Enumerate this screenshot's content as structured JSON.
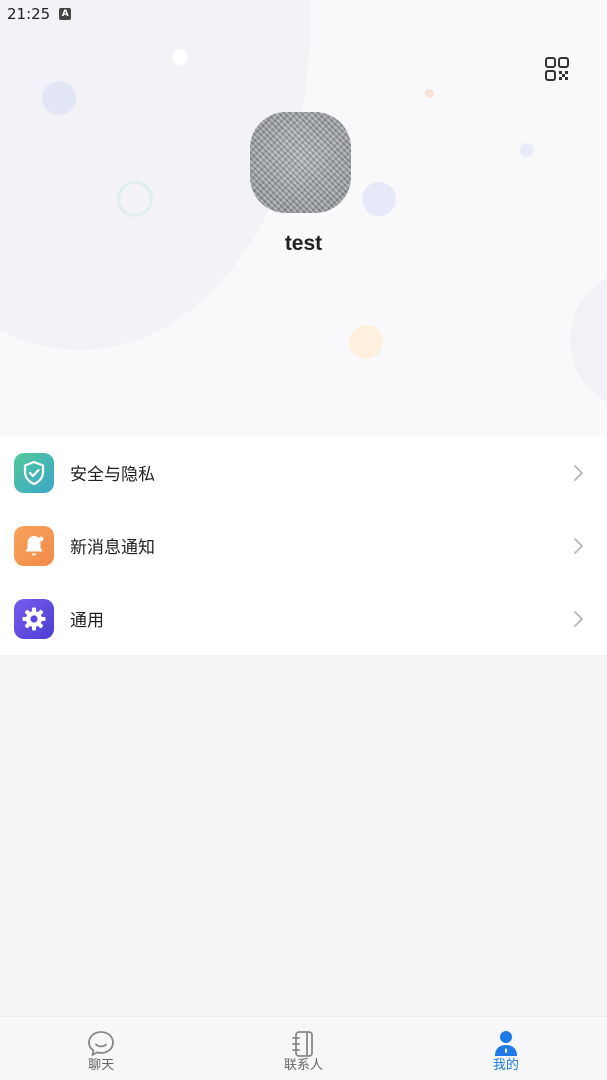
{
  "status_bar": {
    "time": "21:25",
    "indicator": "A"
  },
  "header": {
    "qr_icon": "qr-code-icon",
    "username": "test",
    "avatar": "user-avatar"
  },
  "menu": {
    "items": [
      {
        "label": "安全与隐私",
        "icon": "shield-check-icon",
        "color": "#53c89a"
      },
      {
        "label": "新消息通知",
        "icon": "bell-icon",
        "color": "#f7a35c"
      },
      {
        "label": "通用",
        "icon": "gear-icon",
        "color": "#5b46e0"
      }
    ]
  },
  "bottom_nav": {
    "items": [
      {
        "label": "聊天",
        "icon": "chat-bubble-icon",
        "active": false
      },
      {
        "label": "联系人",
        "icon": "contacts-book-icon",
        "active": false
      },
      {
        "label": "我的",
        "icon": "person-icon",
        "active": true
      }
    ],
    "active_color": "#1e7ae6"
  }
}
